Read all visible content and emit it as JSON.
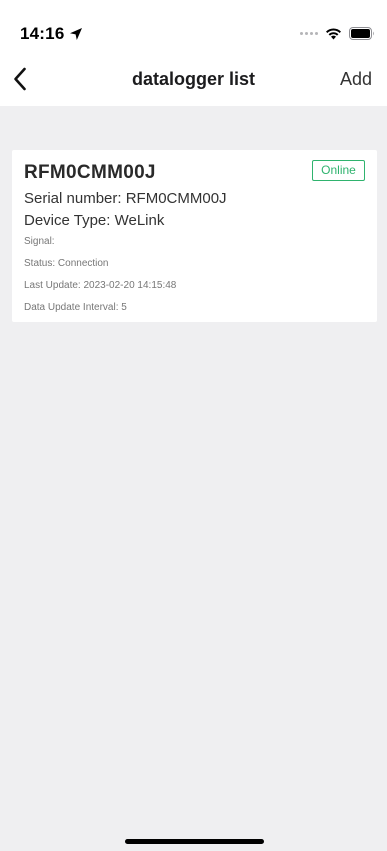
{
  "status_bar": {
    "time": "14:16",
    "location_icon": "location-arrow-icon",
    "wifi_icon": "wifi-icon",
    "battery_icon": "battery-icon"
  },
  "nav": {
    "title": "datalogger list",
    "add_label": "Add",
    "back_icon": "chevron-left-icon"
  },
  "devices": [
    {
      "name": "RFM0CMM00J",
      "status_badge": "Online",
      "serial_number": "Serial number: RFM0CMM00J",
      "device_type": "Device Type: WeLink",
      "signal": "Signal:",
      "status": "Status: Connection",
      "last_update": "Last Update: 2023-02-20 14:15:48",
      "data_update_interval": "Data Update Interval: 5"
    }
  ],
  "colors": {
    "background": "#efeff1",
    "surface": "#ffffff",
    "online_green": "#2fb36e"
  }
}
